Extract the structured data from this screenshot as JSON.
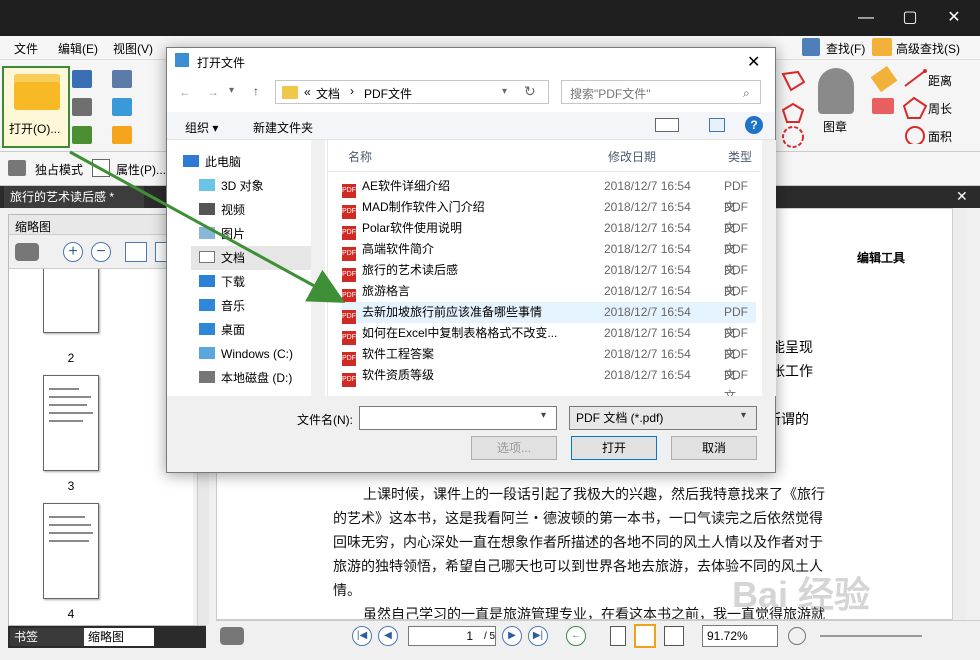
{
  "window": {
    "minimize": "—",
    "maximize": "▢",
    "close": "✕"
  },
  "menu": {
    "file": "文件",
    "edit": "编辑(E)",
    "view": "视图(V)"
  },
  "ribbon": {
    "open_label": "打开(O)...",
    "find": "查找(F)",
    "advanced_find": "高级查找(S)",
    "stamp": "图章",
    "distance": "距离",
    "perimeter": "周长",
    "area": "面积"
  },
  "modebar": {
    "exclusive": "独占模式",
    "properties": "属性(P)..."
  },
  "document_tab": "旅行的艺术读后感 *",
  "left_panel": {
    "title": "缩略图",
    "pages": [
      "2",
      "3",
      "4"
    ],
    "bottom_tabs": [
      "书签",
      "缩略图"
    ]
  },
  "document": {
    "side_label": "编辑工具",
    "fragments": [
      "行为能呈现",
      "的紧张工作",
      "旅者人所谓的"
    ],
    "p1_l1": "上课时候，课件上的一段话引起了我极大的兴趣，然后我特意找来了《旅行",
    "p1_l2": "的艺术》这本书，这是我看阿兰・德波顿的第一本书，一口气读完之后依然觉得",
    "p1_l3": "回味无穷，内心深处一直在想象作者所描述的各地不同的风土人情以及作者对于",
    "p1_l4": "旅游的独特领悟，希望自己哪天也可以到世界各地去旅游，去体验不同的风土人",
    "p1_l5": "情。",
    "p2_l1": "虽然自己学习的一直是旅游管理专业，在看这本书之前，我一直觉得旅游就"
  },
  "status": {
    "page": "1",
    "page_total": "/ 5",
    "zoom": "91.72%"
  },
  "dialog": {
    "title": "打开文件",
    "close": "✕",
    "path_prefix": "«",
    "path_1": "文档",
    "path_sep": "›",
    "path_2": "PDF文件",
    "search_placeholder": "搜索\"PDF文件\"",
    "organize": "组织 ▾",
    "new_folder": "新建文件夹",
    "help": "?",
    "tree": [
      "此电脑",
      "3D 对象",
      "视频",
      "图片",
      "文档",
      "下载",
      "音乐",
      "桌面",
      "Windows (C:)",
      "本地磁盘 (D:)"
    ],
    "columns": {
      "name": "名称",
      "date": "修改日期",
      "type": "类型"
    },
    "files": [
      {
        "name": "AE软件详细介绍",
        "date": "2018/12/7 16:54",
        "type": "PDF 文"
      },
      {
        "name": "MAD制作软件入门介绍",
        "date": "2018/12/7 16:54",
        "type": "PDF 文"
      },
      {
        "name": "Polar软件使用说明",
        "date": "2018/12/7 16:54",
        "type": "PDF 文"
      },
      {
        "name": "高端软件简介",
        "date": "2018/12/7 16:54",
        "type": "PDF 文"
      },
      {
        "name": "旅行的艺术读后感",
        "date": "2018/12/7 16:54",
        "type": "PDF 文"
      },
      {
        "name": "旅游格言",
        "date": "2018/12/7 16:54",
        "type": "PDF 文"
      },
      {
        "name": "去新加坡旅行前应该准备哪些事情",
        "date": "2018/12/7 16:54",
        "type": "PDF 文"
      },
      {
        "name": "如何在Excel中复制表格格式不改变...",
        "date": "2018/12/7 16:54",
        "type": "PDF 文"
      },
      {
        "name": "软件工程答案",
        "date": "2018/12/7 16:54",
        "type": "PDF 文"
      },
      {
        "name": "软件资质等级",
        "date": "2018/12/7 16:54",
        "type": "PDF 文"
      }
    ],
    "file_name_label": "文件名(N):",
    "file_name_value": "",
    "file_type": "PDF 文档 (*.pdf)",
    "options": "选项...",
    "open": "打开",
    "cancel": "取消"
  },
  "watermark": "Bai 经验"
}
